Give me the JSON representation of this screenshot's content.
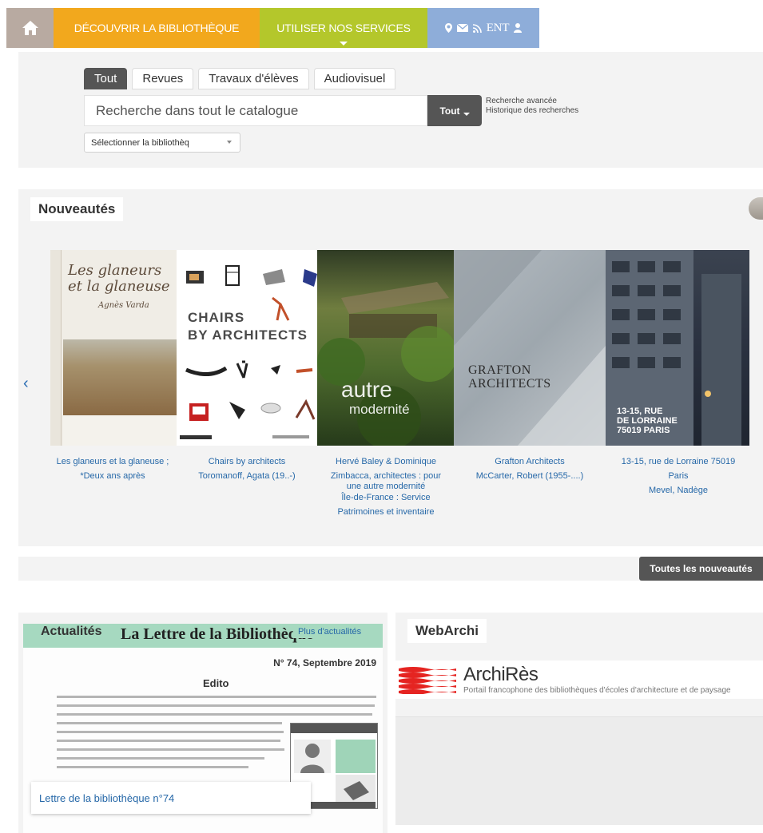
{
  "nav": {
    "home_icon": "home-icon",
    "discover": "DÉCOUVRIR LA BIBLIOTHÈQUE",
    "services": "UTILISER NOS SERVICES",
    "ent": "ENT",
    "colors": {
      "home": "#b8aaa1",
      "discover": "#f2a81d",
      "services": "#b4c72b",
      "tools": "#8eadd9"
    }
  },
  "search": {
    "tabs": [
      {
        "label": "Tout",
        "active": true
      },
      {
        "label": "Revues",
        "active": false
      },
      {
        "label": "Travaux d'élèves",
        "active": false
      },
      {
        "label": "Audiovisuel",
        "active": false
      }
    ],
    "placeholder": "Recherche dans tout le catalogue",
    "scope_label": "Tout",
    "advanced_link": "Recherche avancée",
    "history_link": "Historique des recherches",
    "library_select": "Sélectionner la bibliothèq"
  },
  "new_items": {
    "title": "Nouveautés",
    "covers": [
      {
        "cover_text": "Les glaneurs et la glaneuse",
        "cover_sub": "Agnès Varda",
        "caption": [
          "Les glaneurs et la glaneuse ;",
          "*Deux ans après"
        ]
      },
      {
        "cover_text": "CHAIRS",
        "cover_sub": "BY ARCHITECTS",
        "caption": [
          "Chairs by architects",
          "Toromanoff, Agata (19..-)"
        ]
      },
      {
        "cover_text": "autre",
        "cover_sub": "modernité",
        "caption": [
          "Hervé Baley & Dominique",
          "Zimbacca, architectes : pour",
          "une autre modernité",
          "Île-de-France : Service",
          "Patrimoines et inventaire"
        ]
      },
      {
        "cover_text": "GRAFTON",
        "cover_sub": "ARCHITECTS",
        "caption": [
          "Grafton Architects",
          "McCarter, Robert (1955-....)"
        ]
      },
      {
        "cover_text": "13-15, RUE",
        "cover_sub": "DE LORRAINE",
        "cover_sub2": "75019 PARIS",
        "caption": [
          "13-15, rue de Lorraine 75019",
          "Paris",
          "Mevel, Nadège"
        ]
      }
    ],
    "all_button": "Toutes les nouveautés"
  },
  "news": {
    "title": "Actualités",
    "more_link": "Plus d'actualités",
    "letter_header": "La Lettre de la Bibliothèque",
    "letter_number": "N° 74, Septembre 2019",
    "letter_edito": "Edito",
    "card_title": "Lettre de la bibliothèque n°74"
  },
  "webarchi": {
    "title": "WebArchi",
    "brand": "ArchiRès",
    "tagline": "Portail francophone des bibliothèques d'écoles d'architecture et de paysage"
  }
}
